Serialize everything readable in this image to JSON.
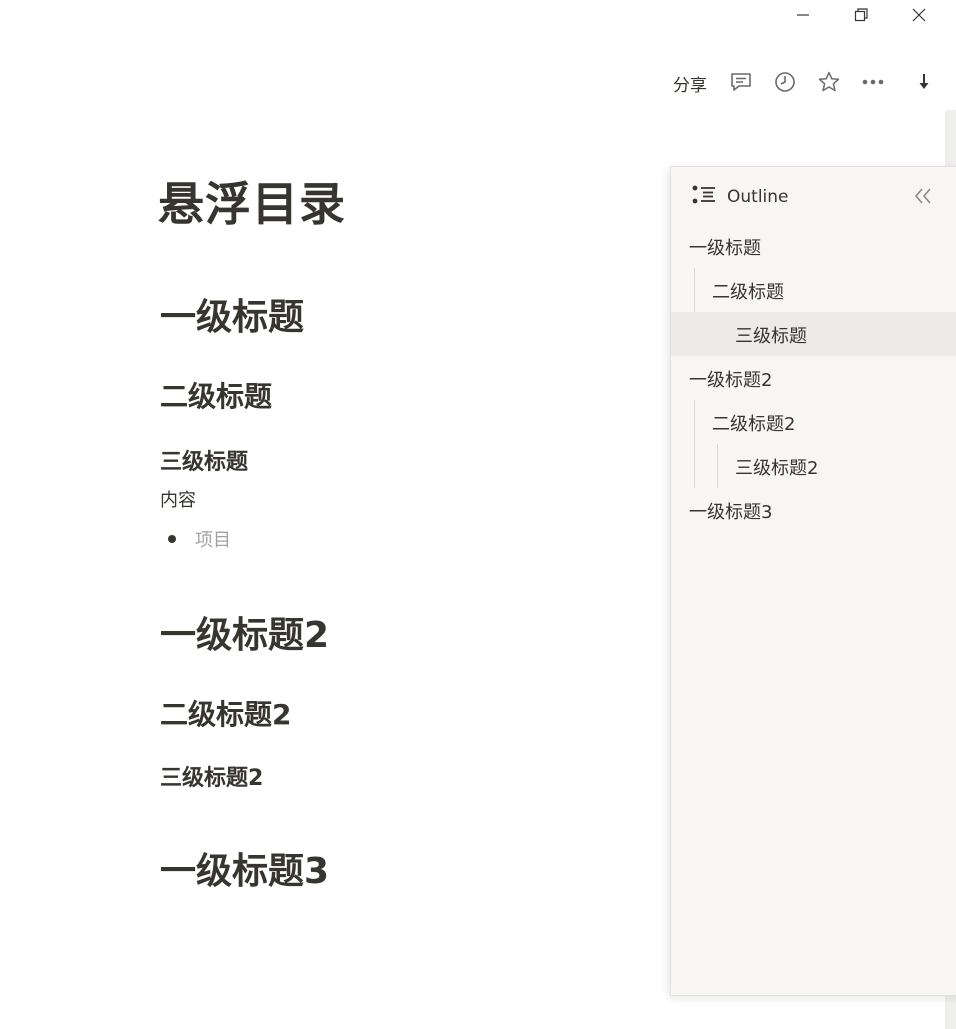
{
  "window": {
    "controls": [
      "minimize",
      "restore",
      "close"
    ]
  },
  "toolbar": {
    "share_label": "分享",
    "icons": [
      "comment-icon",
      "history-icon",
      "star-icon",
      "more-icon",
      "download-icon"
    ]
  },
  "document": {
    "title": "悬浮目录",
    "blocks": {
      "h1_a": "一级标题",
      "h2_a": "二级标题",
      "h3_a": "三级标题",
      "paragraph": "内容",
      "bullet": "项目",
      "h1_b": "一级标题2",
      "h2_b": "二级标题2",
      "h3_b": "三级标题2",
      "h1_c": "一级标题3"
    }
  },
  "outline": {
    "title": "Outline",
    "items": [
      {
        "label": "一级标题",
        "level": 1
      },
      {
        "label": "二级标题",
        "level": 2
      },
      {
        "label": "三级标题",
        "level": 3,
        "active": true
      },
      {
        "label": "一级标题2",
        "level": 1
      },
      {
        "label": "二级标题2",
        "level": 2
      },
      {
        "label": "三级标题2",
        "level": 3
      },
      {
        "label": "一级标题3",
        "level": 1
      }
    ]
  }
}
